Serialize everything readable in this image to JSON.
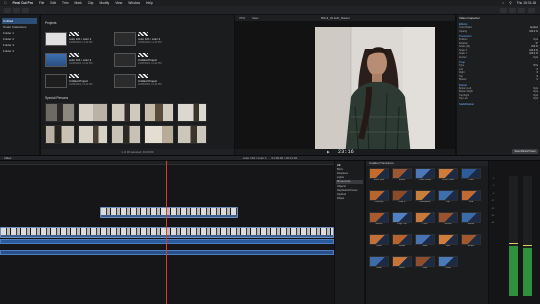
{
  "menubar": {
    "app": "Final Cut Pro",
    "items": [
      "File",
      "Edit",
      "Trim",
      "Mark",
      "Clip",
      "Modify",
      "View",
      "Window",
      "Help"
    ],
    "clock": "Thu 15:31:18"
  },
  "libraries": {
    "items": [
      "Untitled",
      "Smart Collections",
      "Folder 1",
      "Folder 2",
      "Folder 3",
      "Folder 4"
    ],
    "selected_index": 0
  },
  "browser": {
    "projects_title": "Projects",
    "projects": [
      {
        "title": "color 101 / color 1",
        "meta": "10/08/2024, 11:44 PM"
      },
      {
        "title": "color 101 / color 2",
        "meta": "10/08/2024, 11:44 PM"
      },
      {
        "title": "color 101 / color 3",
        "meta": "10/08/2024, 11:44 PM"
      },
      {
        "title": "Untitled Project",
        "meta": "10/08/2024, 11:44 PM"
      },
      {
        "title": "Untitled Project",
        "meta": "10/08/2024, 11:44 PM"
      },
      {
        "title": "Untitled Project",
        "meta": "10/08/2024, 11:44 PM"
      }
    ],
    "clips_title": "Special Persons",
    "footer": "1 of 18 selected, 01:00:00"
  },
  "viewer": {
    "title": "BRoll_02 Edit_Master",
    "zoom": "70%",
    "view": "View",
    "timecode": "23:16"
  },
  "inspector": {
    "title": "Video Inspector",
    "sections": [
      {
        "name": "Effects",
        "rows": [
          [
            "Color Board",
            "Applied"
          ],
          [
            "Opacity",
            "100.0 %"
          ]
        ]
      },
      {
        "name": "Transform",
        "rows": [
          [
            "Position",
            "0 px"
          ],
          [
            "Rotation",
            "0°"
          ],
          [
            "Scale (All)",
            "100 %"
          ],
          [
            "Scale X",
            "100.0 %"
          ],
          [
            "Scale Y",
            "100.0 %"
          ],
          [
            "Anchor",
            "0 px"
          ]
        ]
      },
      {
        "name": "Crop",
        "rows": [
          [
            "Type",
            "Trim"
          ],
          [
            "Left",
            "0"
          ],
          [
            "Right",
            "0"
          ],
          [
            "Top",
            "0"
          ],
          [
            "Bottom",
            "0"
          ]
        ]
      },
      {
        "name": "Distort",
        "rows": [
          [
            "Bottom Left",
            "0 px"
          ],
          [
            "Bottom Right",
            "0 px"
          ],
          [
            "Top Right",
            "0 px"
          ],
          [
            "Top Left",
            "0 px"
          ]
        ]
      },
      {
        "name": "Stabilization",
        "rows": []
      }
    ],
    "save_label": "Save Effects Preset"
  },
  "timeline": {
    "label": "Index",
    "project": "color 101 / color 1",
    "duration": "01:00:00 / 02:11:02"
  },
  "effects_browser": {
    "title": "Installed Transitions",
    "categories": [
      "All",
      "Blurs",
      "Dissolves",
      "Lights",
      "Movements",
      "Objects",
      "Replicator/Clones",
      "Stylized",
      "Wipes"
    ],
    "selected_category": 4,
    "items": [
      {
        "label": "Black Hole",
        "color": "#c46a2a"
      },
      {
        "label": "Bloom",
        "color": "#9c5630"
      },
      {
        "label": "Color Planes",
        "color": "#4d78b8"
      },
      {
        "label": "Cross Zoom",
        "color": "#d17a3a"
      },
      {
        "label": "Cube",
        "color": "#2c5c9a"
      },
      {
        "label": "Doorway",
        "color": "#b7652e"
      },
      {
        "label": "Drop In",
        "color": "#8a4a2a"
      },
      {
        "label": "Earthquake",
        "color": "#c77f3c"
      },
      {
        "label": "Flip",
        "color": "#3d6fae"
      },
      {
        "label": "Grid",
        "color": "#c06b34"
      },
      {
        "label": "Mosaic",
        "color": "#a85a2e"
      },
      {
        "label": "Page Curl",
        "color": "#4f82c0"
      },
      {
        "label": "Push",
        "color": "#c9783a"
      },
      {
        "label": "Reveal",
        "color": "#9a5330"
      },
      {
        "label": "Rotate",
        "color": "#3a6aa8"
      },
      {
        "label": "Scale",
        "color": "#c2703a"
      },
      {
        "label": "Shape",
        "color": "#b5632f"
      },
      {
        "label": "Slide",
        "color": "#4773b2"
      },
      {
        "label": "Spin",
        "color": "#cf7d3d"
      },
      {
        "label": "Stripes",
        "color": "#a2572f"
      },
      {
        "label": "Swap",
        "color": "#3e6cab"
      },
      {
        "label": "Wave",
        "color": "#c6753a"
      },
      {
        "label": "Wipe",
        "color": "#8e4d2c"
      },
      {
        "label": "Zoom",
        "color": "#4a7bb9"
      }
    ]
  },
  "meters": {
    "scale": [
      "6",
      "0",
      "-6",
      "-12",
      "-20",
      "-30",
      "-50"
    ],
    "left_level": 0.42,
    "right_level": 0.4
  }
}
